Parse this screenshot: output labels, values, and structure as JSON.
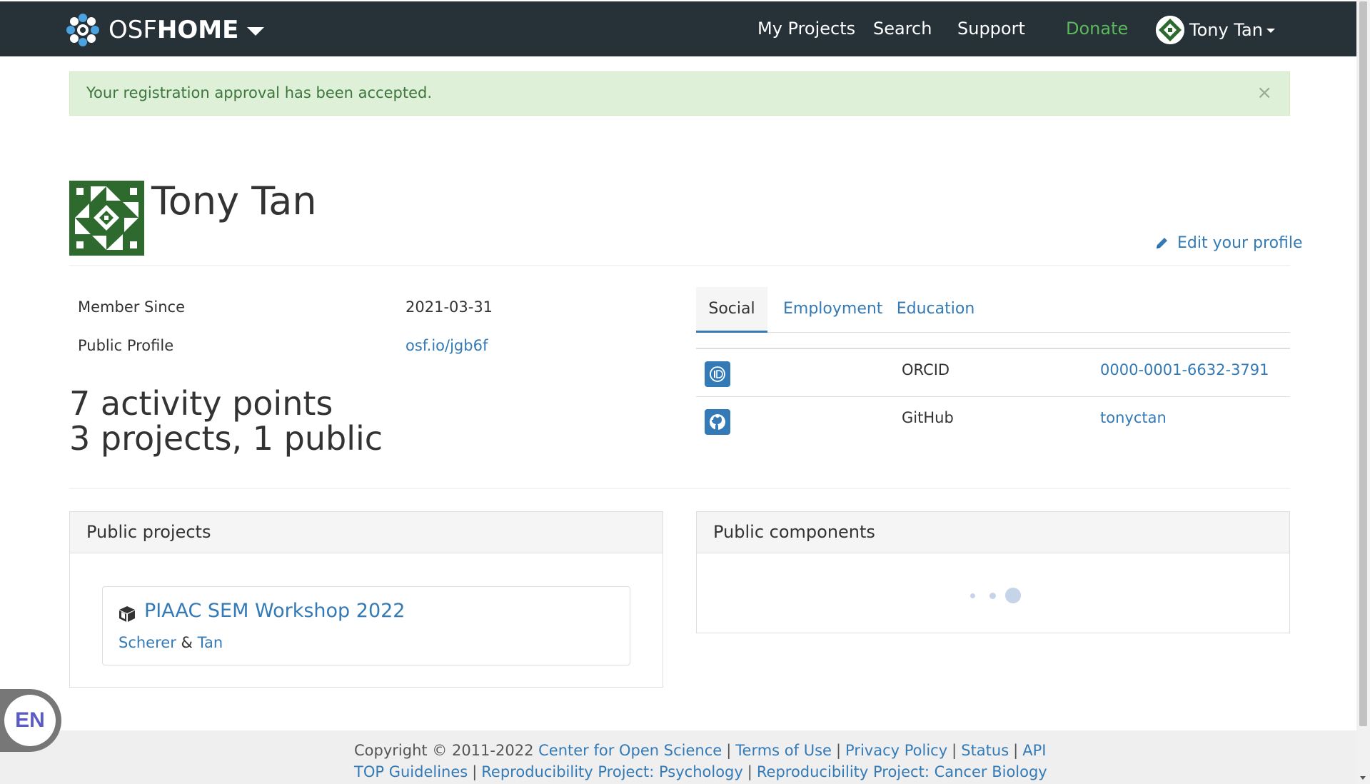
{
  "navbar": {
    "brand_light": "OSF",
    "brand_bold": "HOME",
    "links": [
      {
        "label": "My Projects"
      },
      {
        "label": "Search"
      },
      {
        "label": "Support"
      },
      {
        "label": "Donate"
      }
    ],
    "user_name": "Tony Tan"
  },
  "alert": {
    "message": "Your registration approval has been accepted.",
    "close": "×"
  },
  "profile": {
    "name": "Tony Tan",
    "edit_label": "Edit your profile",
    "member_since_label": "Member Since",
    "member_since_value": "2021-03-31",
    "public_profile_label": "Public Profile",
    "public_profile_value": "osf.io/jgb6f",
    "activity_points": "7 activity points",
    "projects_summary": "3 projects, 1 public"
  },
  "tabs": [
    {
      "label": "Social"
    },
    {
      "label": "Employment"
    },
    {
      "label": "Education"
    }
  ],
  "social": [
    {
      "icon": "orcid-icon",
      "name": "ORCID",
      "value": "0000-0001-6632-3791"
    },
    {
      "icon": "github-icon",
      "name": "GitHub",
      "value": "tonyctan"
    }
  ],
  "public_projects": {
    "heading": "Public projects",
    "items": [
      {
        "title": "PIAAC SEM Workshop 2022",
        "author1": "Scherer",
        "amp": "&",
        "author2": "Tan"
      }
    ]
  },
  "public_components": {
    "heading": "Public components"
  },
  "footer": {
    "copyright": "Copyright © 2011-2022",
    "line1_links": [
      "Center for Open Science",
      "Terms of Use",
      "Privacy Policy",
      "Status",
      "API"
    ],
    "line2_links": [
      "TOP Guidelines",
      "Reproducibility Project: Psychology",
      "Reproducibility Project: Cancer Biology"
    ],
    "separator": "|"
  },
  "language": {
    "code": "EN"
  },
  "colors": {
    "navbar_bg": "#263238",
    "link": "#337ab7",
    "donate": "#5cb85c",
    "alert_bg": "#dff0d8",
    "alert_text": "#3c763d",
    "avatar_green": "#2e6a2e"
  }
}
